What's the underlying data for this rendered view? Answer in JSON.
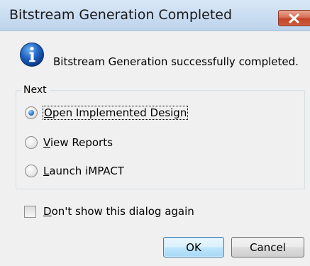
{
  "window": {
    "title": "Bitstream Generation Completed",
    "close_icon": "close-icon"
  },
  "message": {
    "icon": "info-icon",
    "text": "Bitstream Generation successfully completed."
  },
  "next_group": {
    "label": "Next",
    "options": [
      {
        "accel": "O",
        "rest": "pen Implemented Design",
        "selected": true
      },
      {
        "accel": "V",
        "rest": "iew Reports",
        "selected": false
      },
      {
        "accel": "L",
        "rest": "aunch iMPACT",
        "selected": false
      }
    ]
  },
  "dont_show": {
    "accel": "D",
    "rest": "on't show this dialog again",
    "checked": false
  },
  "buttons": {
    "ok": "OK",
    "cancel": "Cancel"
  },
  "colors": {
    "titlebar": "#c9dcf1",
    "close_button": "#c2452a",
    "dialog_background": "#f0f0f0",
    "info_icon": "#1f62c3"
  }
}
